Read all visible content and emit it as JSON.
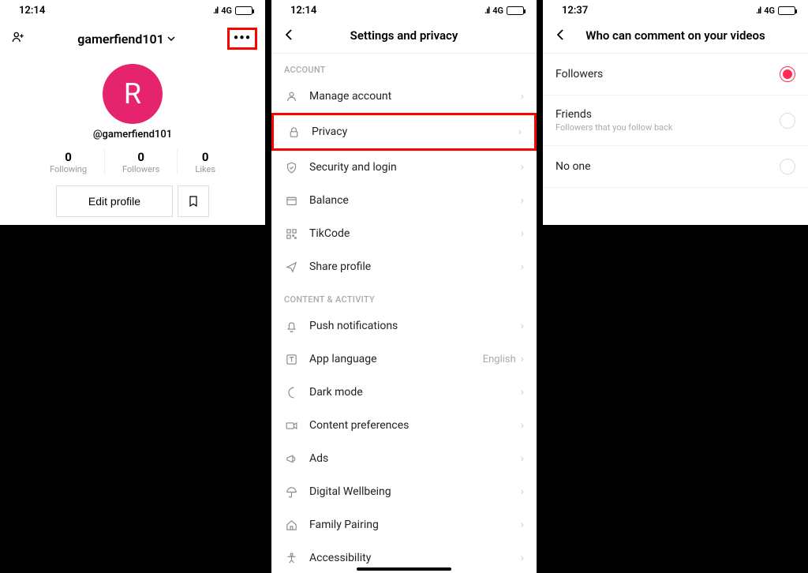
{
  "status": {
    "time1": "12:14",
    "time2": "12:14",
    "time3": "12:37",
    "net": "4G"
  },
  "profile": {
    "username": "gamerfiend101",
    "avatar_letter": "R",
    "handle": "@gamerfiend101",
    "stats": [
      {
        "num": "0",
        "label": "Following"
      },
      {
        "num": "0",
        "label": "Followers"
      },
      {
        "num": "0",
        "label": "Likes"
      }
    ],
    "edit_label": "Edit profile"
  },
  "settings": {
    "title": "Settings and privacy",
    "sections": [
      {
        "header": "ACCOUNT"
      },
      {
        "header": "CONTENT & ACTIVITY"
      }
    ],
    "account_items": [
      {
        "label": "Manage account",
        "icon": "user"
      },
      {
        "label": "Privacy",
        "icon": "lock",
        "highlighted": true
      },
      {
        "label": "Security and login",
        "icon": "shield"
      },
      {
        "label": "Balance",
        "icon": "wallet"
      },
      {
        "label": "TikCode",
        "icon": "qr"
      },
      {
        "label": "Share profile",
        "icon": "share"
      }
    ],
    "content_items": [
      {
        "label": "Push notifications",
        "icon": "bell"
      },
      {
        "label": "App language",
        "icon": "lang",
        "value": "English"
      },
      {
        "label": "Dark mode",
        "icon": "moon"
      },
      {
        "label": "Content preferences",
        "icon": "video"
      },
      {
        "label": "Ads",
        "icon": "megaphone"
      },
      {
        "label": "Digital Wellbeing",
        "icon": "umbrella"
      },
      {
        "label": "Family Pairing",
        "icon": "home"
      },
      {
        "label": "Accessibility",
        "icon": "access"
      }
    ]
  },
  "comments": {
    "title": "Who can comment on your videos",
    "options": [
      {
        "label": "Followers",
        "selected": true
      },
      {
        "label": "Friends",
        "sub": "Followers that you follow back",
        "selected": false
      },
      {
        "label": "No one",
        "selected": false
      }
    ]
  }
}
